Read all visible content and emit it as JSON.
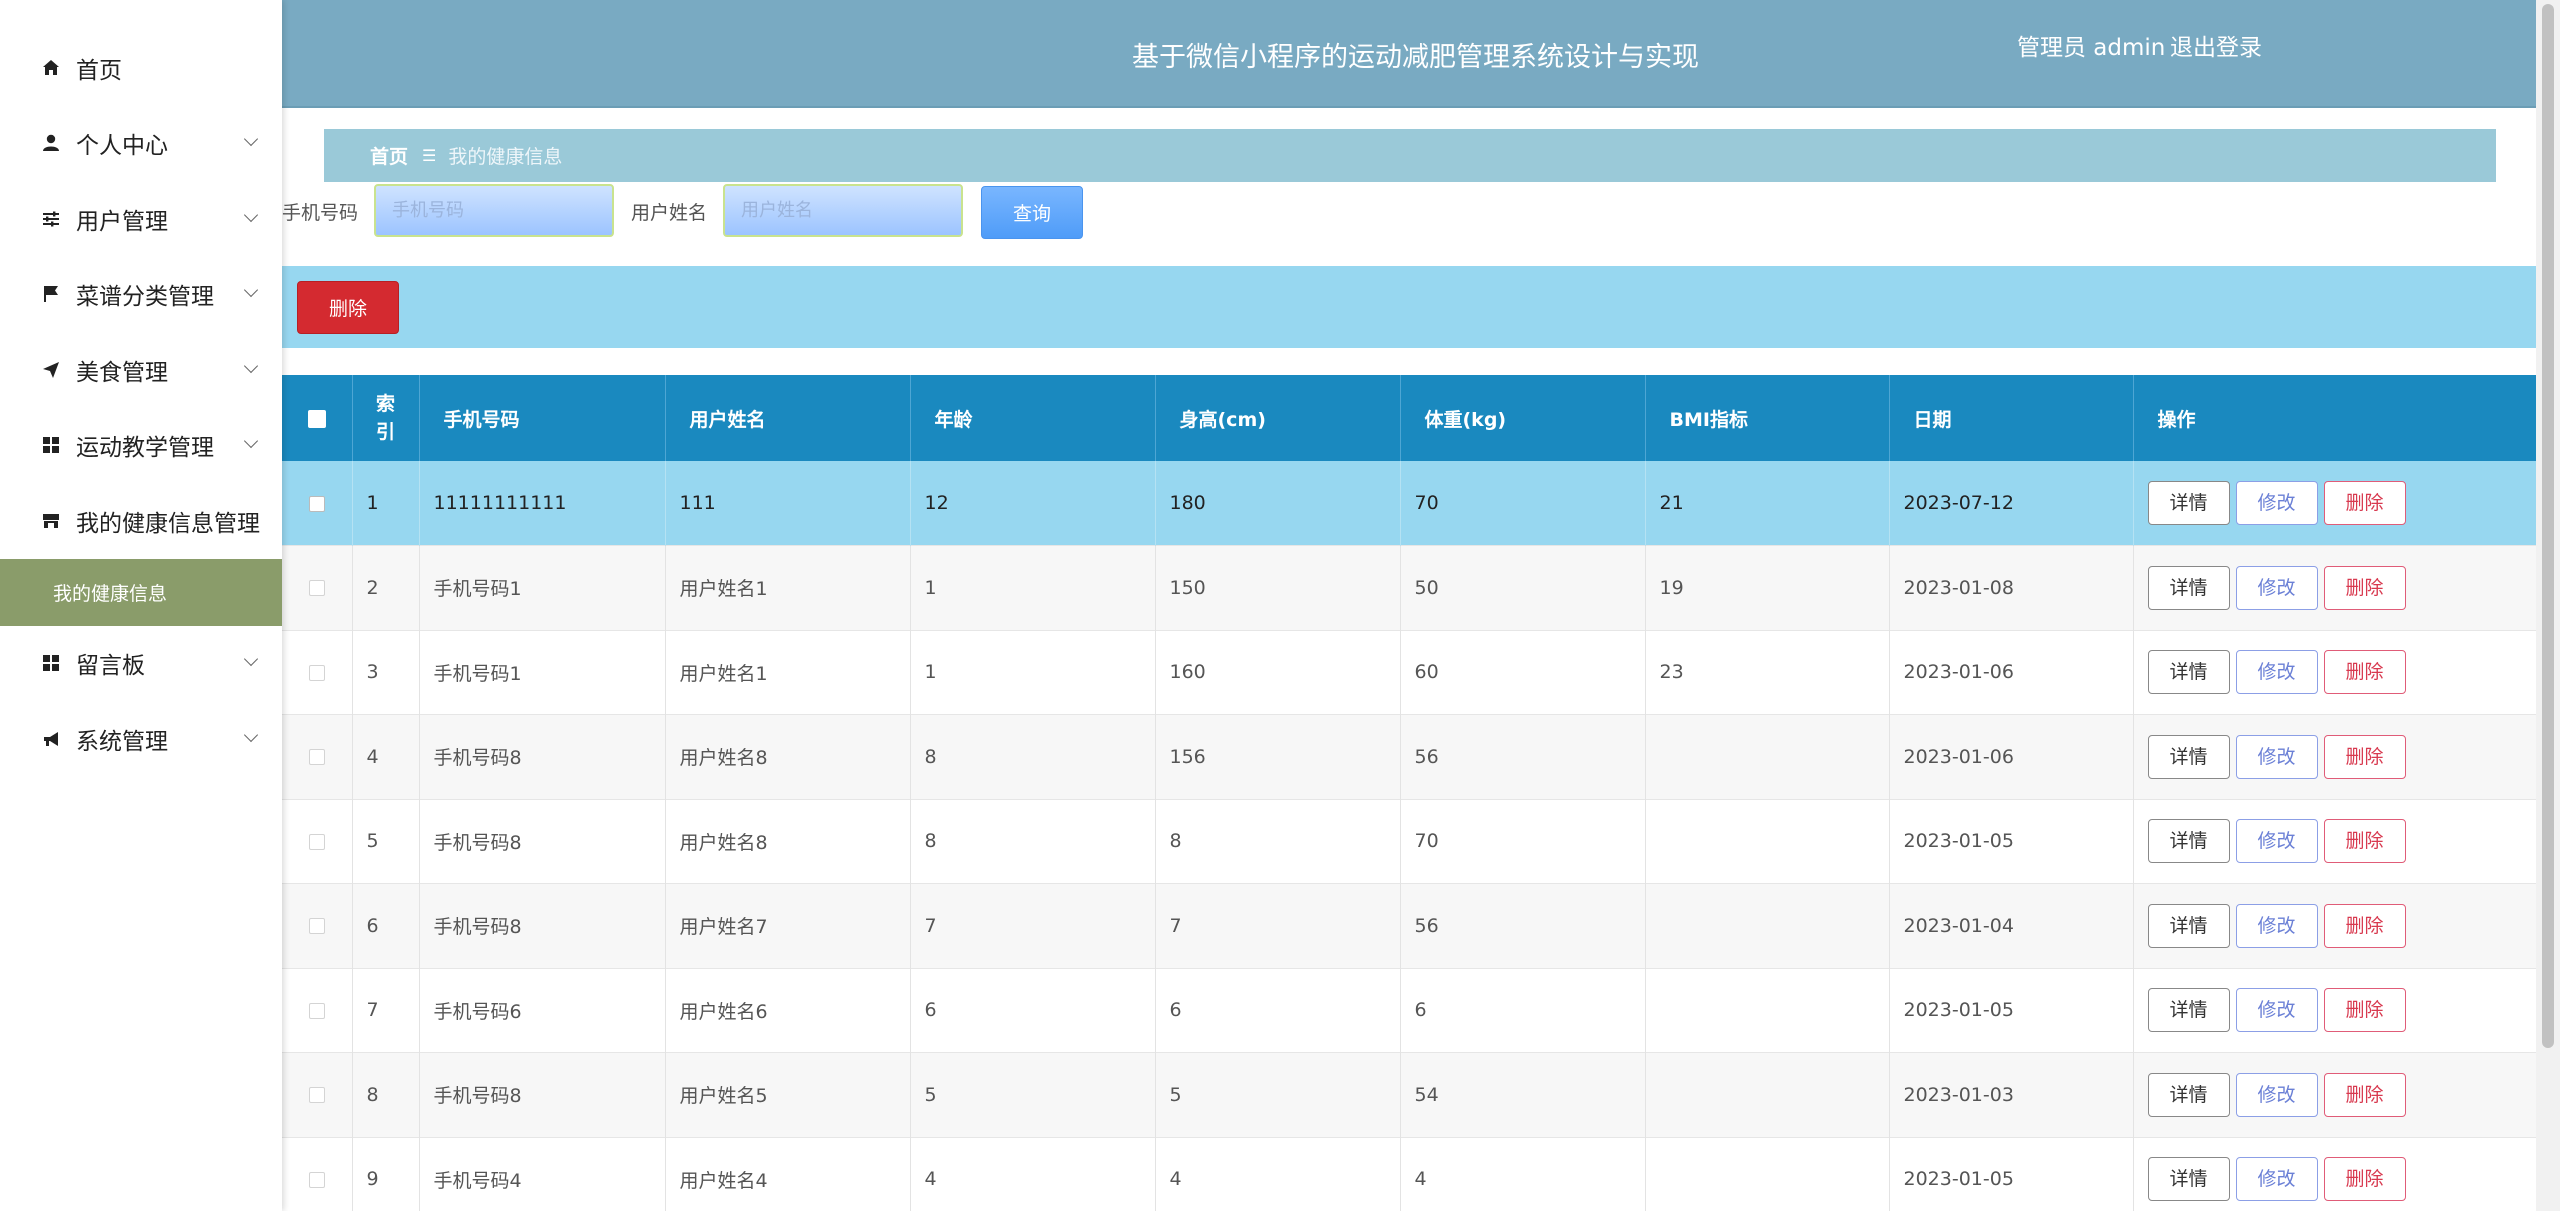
{
  "sidebar": {
    "items": [
      {
        "label": "首页",
        "icon": "home-icon",
        "has_children": false
      },
      {
        "label": "个人中心",
        "icon": "user-icon",
        "has_children": true
      },
      {
        "label": "用户管理",
        "icon": "sliders-icon",
        "has_children": true
      },
      {
        "label": "菜谱分类管理",
        "icon": "flag-icon",
        "has_children": true
      },
      {
        "label": "美食管理",
        "icon": "send-icon",
        "has_children": true
      },
      {
        "label": "运动教学管理",
        "icon": "grid-icon",
        "has_children": true
      },
      {
        "label": "我的健康信息管理",
        "icon": "store-icon",
        "has_children": false
      },
      {
        "label": "留言板",
        "icon": "grid-icon",
        "has_children": true
      },
      {
        "label": "系统管理",
        "icon": "megaphone-icon",
        "has_children": true
      }
    ],
    "active_sub_item": "我的健康信息"
  },
  "header": {
    "title": "基于微信小程序的运动减肥管理系统设计与实现",
    "user_info": "管理员 admin",
    "logout": "退出登录"
  },
  "breadcrumb": {
    "home": "首页",
    "separator": "☰",
    "current": "我的健康信息"
  },
  "search": {
    "phone_label": "手机号码",
    "phone_placeholder": "手机号码",
    "name_label": "用户姓名",
    "name_placeholder": "用户姓名",
    "query_button": "查询"
  },
  "actions": {
    "delete_button": "删除"
  },
  "table": {
    "headers": {
      "index": "索引",
      "phone": "手机号码",
      "name": "用户姓名",
      "age": "年龄",
      "height": "身高(cm)",
      "weight": "体重(kg)",
      "bmi": "BMI指标",
      "date": "日期",
      "ops": "操作"
    },
    "op_labels": {
      "detail": "详情",
      "edit": "修改",
      "delete": "删除"
    },
    "rows": [
      {
        "index": "1",
        "phone": "11111111111",
        "name": "111",
        "age": "12",
        "height": "180",
        "weight": "70",
        "bmi": "21",
        "date": "2023-07-12",
        "selected": true
      },
      {
        "index": "2",
        "phone": "手机号码1",
        "name": "用户姓名1",
        "age": "1",
        "height": "150",
        "weight": "50",
        "bmi": "19",
        "date": "2023-01-08",
        "selected": false
      },
      {
        "index": "3",
        "phone": "手机号码1",
        "name": "用户姓名1",
        "age": "1",
        "height": "160",
        "weight": "60",
        "bmi": "23",
        "date": "2023-01-06",
        "selected": false
      },
      {
        "index": "4",
        "phone": "手机号码8",
        "name": "用户姓名8",
        "age": "8",
        "height": "156",
        "weight": "56",
        "bmi": "",
        "date": "2023-01-06",
        "selected": false
      },
      {
        "index": "5",
        "phone": "手机号码8",
        "name": "用户姓名8",
        "age": "8",
        "height": "8",
        "weight": "70",
        "bmi": "",
        "date": "2023-01-05",
        "selected": false
      },
      {
        "index": "6",
        "phone": "手机号码8",
        "name": "用户姓名7",
        "age": "7",
        "height": "7",
        "weight": "56",
        "bmi": "",
        "date": "2023-01-04",
        "selected": false
      },
      {
        "index": "7",
        "phone": "手机号码6",
        "name": "用户姓名6",
        "age": "6",
        "height": "6",
        "weight": "6",
        "bmi": "",
        "date": "2023-01-05",
        "selected": false
      },
      {
        "index": "8",
        "phone": "手机号码8",
        "name": "用户姓名5",
        "age": "5",
        "height": "5",
        "weight": "54",
        "bmi": "",
        "date": "2023-01-03",
        "selected": false
      },
      {
        "index": "9",
        "phone": "手机号码4",
        "name": "用户姓名4",
        "age": "4",
        "height": "4",
        "weight": "4",
        "bmi": "",
        "date": "2023-01-05",
        "selected": false
      }
    ]
  },
  "colors": {
    "header_bg": "#79aac2",
    "breadcrumb_bg": "#9ac9d8",
    "action_bar_bg": "#97d7f0",
    "table_header_bg": "#1a89bf",
    "active_submenu_bg": "#8a9c6a",
    "danger": "#d42a30",
    "primary": "#4f9cf8"
  }
}
